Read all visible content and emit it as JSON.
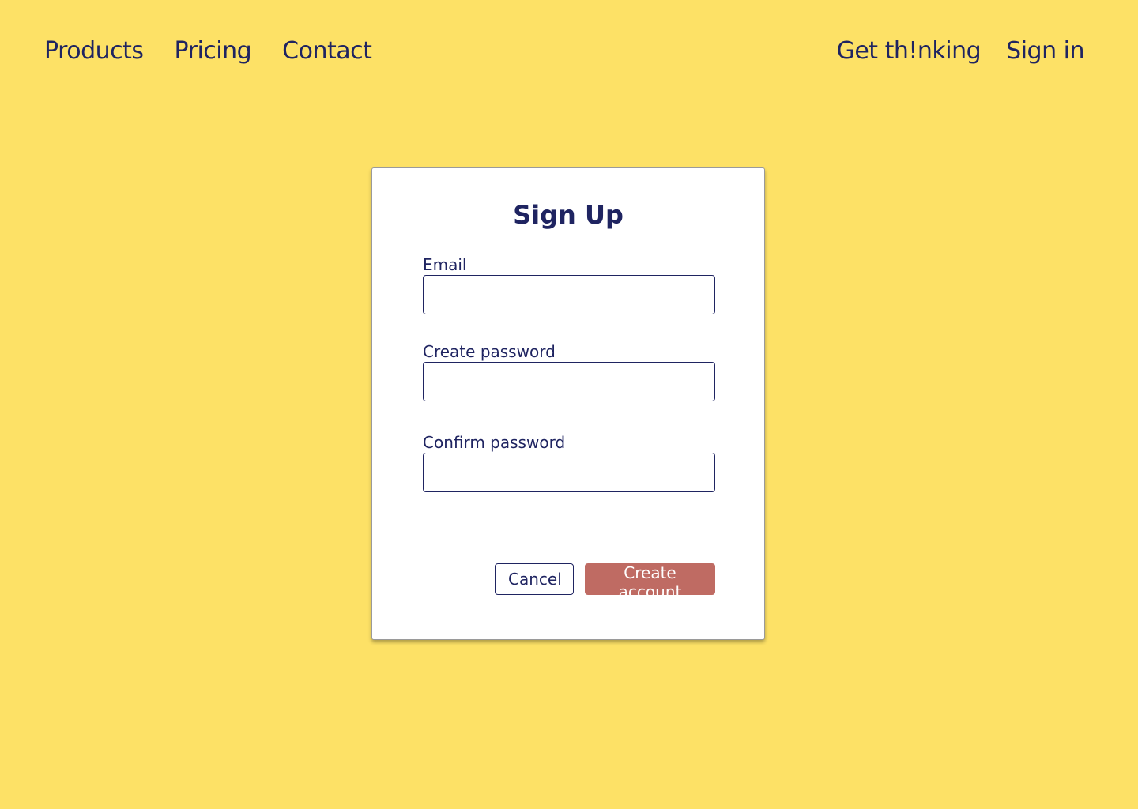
{
  "nav": {
    "left": [
      {
        "label": "Products"
      },
      {
        "label": "Pricing"
      },
      {
        "label": "Contact"
      }
    ],
    "right": [
      {
        "label": "Get th!nking"
      },
      {
        "label": "Sign in"
      }
    ]
  },
  "form": {
    "title": "Sign Up",
    "fields": [
      {
        "label": "Email",
        "value": "",
        "placeholder": ""
      },
      {
        "label": "Create password",
        "value": "",
        "placeholder": ""
      },
      {
        "label": "Confirm password",
        "value": "",
        "placeholder": ""
      }
    ],
    "cancel_label": "Cancel",
    "submit_label": "Create account"
  },
  "colors": {
    "background": "#fde166",
    "text": "#1f2461",
    "primary_button": "#bf6b63"
  }
}
